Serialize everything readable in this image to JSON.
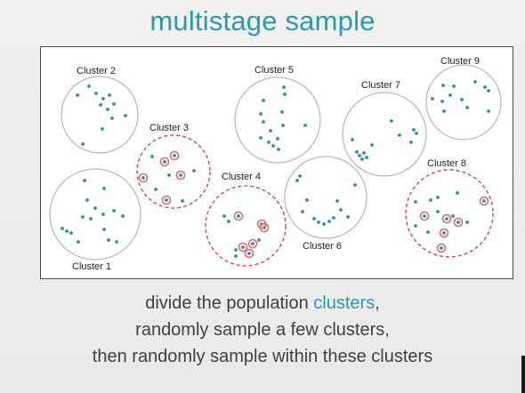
{
  "title": "multistage sample",
  "clusters": [
    {
      "label": "Cluster 1",
      "sampled": false
    },
    {
      "label": "Cluster 2",
      "sampled": false
    },
    {
      "label": "Cluster 3",
      "sampled": true
    },
    {
      "label": "Cluster 4",
      "sampled": true
    },
    {
      "label": "Cluster 5",
      "sampled": false
    },
    {
      "label": "Cluster 6",
      "sampled": false
    },
    {
      "label": "Cluster 7",
      "sampled": false
    },
    {
      "label": "Cluster 8",
      "sampled": true
    },
    {
      "label": "Cluster 9",
      "sampled": false
    }
  ],
  "caption": {
    "line1_prefix": "divide the population ",
    "line1_highlight": "clusters",
    "line1_suffix": ",",
    "line2": "randomly sample a few clusters,",
    "line3": "then randomly sample within these clusters"
  },
  "colors": {
    "accent": "#2a9ab0",
    "dot": "#2f8ea6",
    "sampled_border": "#d63a3a",
    "sampled_ring": "#e06a6a",
    "circle_border": "#b9b9b9"
  }
}
